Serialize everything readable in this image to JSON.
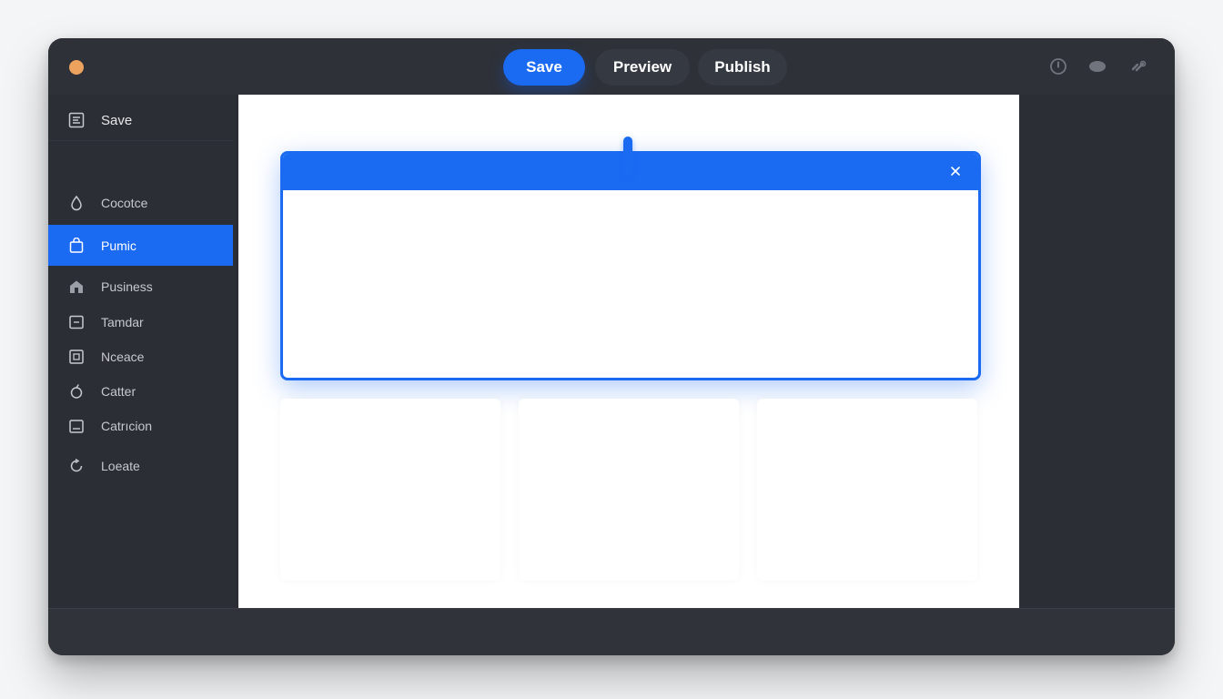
{
  "toolbar": {
    "save_label": "Save",
    "preview_label": "Preview",
    "publish_label": "Publish",
    "icons": [
      "info-icon",
      "chat-bubble-icon",
      "link-icon"
    ]
  },
  "sidebar": {
    "items": [
      {
        "label": "Save",
        "icon": "save-icon"
      },
      {
        "label": "Cocotce",
        "icon": "drop-icon"
      },
      {
        "label": "Pumic",
        "icon": "bag-icon",
        "active": true
      },
      {
        "label": "Pusiness",
        "icon": "briefcase-icon"
      },
      {
        "label": "Tamdar",
        "icon": "square-icon"
      },
      {
        "label": "Nceace",
        "icon": "frame-icon"
      },
      {
        "label": "Catter",
        "icon": "bell-icon"
      },
      {
        "label": "Catrıcion",
        "icon": "calendar-icon"
      },
      {
        "label": "Loeate",
        "icon": "refresh-icon"
      }
    ]
  },
  "modal": {
    "close_icon": "close-icon"
  },
  "colors": {
    "accent": "#1a6af2",
    "window_bg": "#2b2e35",
    "traffic_dot": "#eda25e"
  }
}
